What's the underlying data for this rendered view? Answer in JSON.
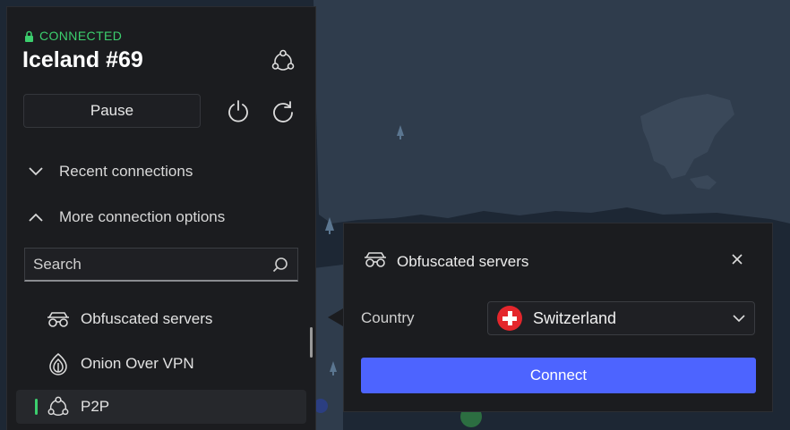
{
  "status": {
    "text": "CONNECTED",
    "icon": "lock-icon",
    "color": "#3ccf6e"
  },
  "server": {
    "name": "Iceland #69",
    "icon": "p2p-icon"
  },
  "controls": {
    "pause_label": "Pause",
    "power_icon": "power-icon",
    "reconnect_icon": "refresh-icon"
  },
  "sections": {
    "recent": {
      "label": "Recent connections",
      "icon": "chevron-down-icon"
    },
    "more": {
      "label": "More connection options",
      "icon": "chevron-up-icon"
    }
  },
  "search": {
    "placeholder": "Search",
    "icon": "search-icon"
  },
  "options": [
    {
      "label": "Obfuscated servers",
      "icon": "obfuscated-icon"
    },
    {
      "label": "Onion Over VPN",
      "icon": "onion-icon"
    },
    {
      "label": "P2P",
      "icon": "p2p-icon",
      "active": true
    }
  ],
  "popup": {
    "title": "Obfuscated servers",
    "title_icon": "obfuscated-icon",
    "country_label": "Country",
    "country_value": "Switzerland",
    "flag_icon": "swiss-flag-icon",
    "connect_label": "Connect",
    "accent": "#4d64ff"
  }
}
